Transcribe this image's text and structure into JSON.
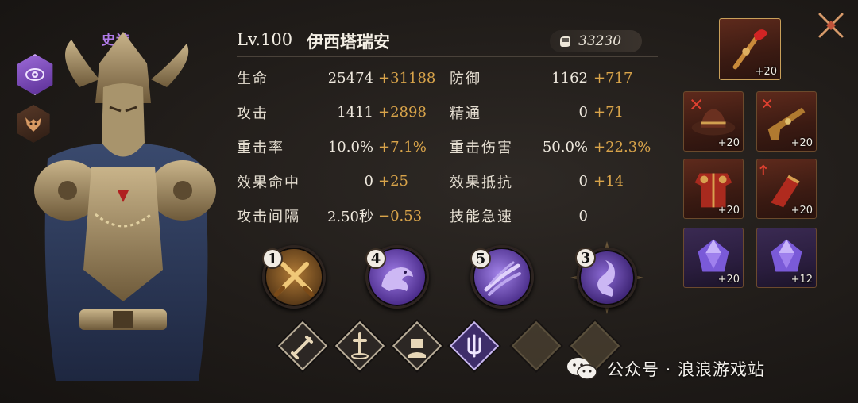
{
  "character": {
    "rarity": "史诗",
    "level": "Lv.100",
    "name": "伊西塔瑞安",
    "power": "33230"
  },
  "stats": [
    {
      "left": {
        "label": "生命",
        "base": "25474",
        "bonus": "+31188"
      },
      "right": {
        "label": "防御",
        "base": "1162",
        "bonus": "+717"
      }
    },
    {
      "left": {
        "label": "攻击",
        "base": "1411",
        "bonus": "+2898"
      },
      "right": {
        "label": "精通",
        "base": "0",
        "bonus": "+71"
      }
    },
    {
      "left": {
        "label": "重击率",
        "base": "10.0%",
        "bonus": "+7.1%"
      },
      "right": {
        "label": "重击伤害",
        "base": "50.0%",
        "bonus": "+22.3%"
      }
    },
    {
      "left": {
        "label": "效果命中",
        "base": "0",
        "bonus": "+25"
      },
      "right": {
        "label": "效果抵抗",
        "base": "0",
        "bonus": "+14"
      }
    },
    {
      "left": {
        "label": "攻击间隔",
        "base": "2.50秒",
        "bonus": "−0.53"
      },
      "right": {
        "label": "技能急速",
        "base": "0",
        "bonus": ""
      }
    }
  ],
  "skills": [
    {
      "rank": "1",
      "icon": "crossed-swords-icon"
    },
    {
      "rank": "4",
      "icon": "dragon-icon"
    },
    {
      "rank": "5",
      "icon": "claw-slash-icon"
    },
    {
      "rank": "3",
      "icon": "serpent-icon"
    }
  ],
  "runes": [
    {
      "icon": "sword-rune-icon",
      "state": "filled"
    },
    {
      "icon": "dagger-rune-icon",
      "state": "filled"
    },
    {
      "icon": "fist-rune-icon",
      "state": "filled"
    },
    {
      "icon": "trident-rune-icon",
      "state": "purple"
    },
    {
      "icon": "empty-rune-slot",
      "state": "empty"
    },
    {
      "icon": "empty-rune-slot",
      "state": "empty"
    }
  ],
  "equipment": {
    "main": {
      "icon": "crimson-staff-icon",
      "plus": "+20"
    },
    "slots": [
      {
        "icon": "hat-icon",
        "plus": "+20"
      },
      {
        "icon": "pistol-icon",
        "plus": "+20"
      },
      {
        "icon": "armor-icon",
        "plus": "+20"
      },
      {
        "icon": "gauntlet-icon",
        "plus": "+20"
      },
      {
        "icon": "gem-icon",
        "plus": "+20"
      },
      {
        "icon": "gem-icon",
        "plus": "+12"
      }
    ]
  },
  "watermark": {
    "text": "公众号 · 浪浪游戏站"
  },
  "colors": {
    "rarity": "#b07ae8",
    "bonus": "#d9a44a",
    "text": "#e8e2d6"
  }
}
